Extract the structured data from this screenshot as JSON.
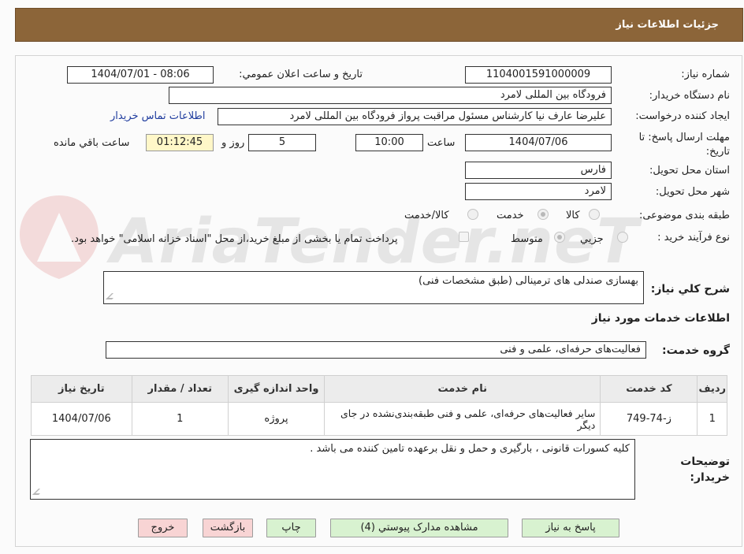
{
  "header": {
    "title": "جزئیات اطلاعات نیاز"
  },
  "form": {
    "need_number": {
      "label": "شماره نیاز:",
      "value": "1104001591000009"
    },
    "announce_date": {
      "label": "تاریخ و ساعت اعلان عمومي:",
      "value": "1404/07/01 - 08:06"
    },
    "buyer_org": {
      "label": "نام دستگاه خریدار:",
      "value": "فرودگاه بین المللی لامرد"
    },
    "requester": {
      "label": "ایجاد کننده درخواست:",
      "value": "علیرضا عارف نیا کارشناس مسئول مراقبت پرواز فرودگاه بین المللی لامرد"
    },
    "buyer_contact_link": "اطلاعات تماس خریدار",
    "deadline": {
      "label": "مهلت ارسال پاسخ: تا تاریخ:",
      "date": "1404/07/06",
      "time_label": "ساعت",
      "time": "10:00",
      "days": "5",
      "days_label": "روز و",
      "remaining": "01:12:45",
      "remaining_label": "ساعت باقي مانده"
    },
    "province": {
      "label": "استان محل تحویل:",
      "value": "فارس"
    },
    "city": {
      "label": "شهر محل تحویل:",
      "value": "لامرد"
    },
    "category": {
      "label": "طبقه بندی موضوعی:",
      "options": [
        "کالا",
        "خدمت",
        "کالا/خدمت"
      ],
      "selected": "خدمت"
    },
    "process": {
      "label": "نوع فرآیند خرید :",
      "options": [
        "جزيي",
        "متوسط"
      ],
      "selected": "متوسط",
      "payment_note": "پرداخت تمام یا بخشی از مبلغ خرید،از محل \"اسناد خزانه اسلامی\" خواهد بود."
    },
    "summary": {
      "label": "شرح کلي نیاز:",
      "value": "بهسازی صندلی های ترمینالی (طبق مشخصات فنی)"
    },
    "services_heading": "اطلاعات خدمات مورد نیاز",
    "service_group": {
      "label": "گروه خدمت:",
      "value": "فعالیت‌های حرفه‌ای، علمی و فنی"
    },
    "table": {
      "headers": [
        "ردیف",
        "کد خدمت",
        "نام خدمت",
        "واحد اندازه گیری",
        "تعداد / مقدار",
        "تاریخ نیاز"
      ],
      "rows": [
        [
          "1",
          "ز-74-749",
          "سایر فعالیت‌های حرفه‌ای، علمی و فنی طبقه‌بندی‌نشده در جای دیگر",
          "پروژه",
          "1",
          "1404/07/06"
        ]
      ]
    },
    "buyer_notes": {
      "label": "توضیحات خریدار:",
      "value": "کلیه کسورات قانونی ، بارگیری و حمل و نقل برعهده تامین کننده می باشد ."
    }
  },
  "buttons": {
    "reply": "پاسخ به نیاز",
    "attachments": "مشاهده مدارک پیوستي (4)",
    "print": "چاپ",
    "back": "بازگشت",
    "exit": "خروج"
  },
  "watermark": "AriaTender.neT",
  "colors": {
    "header_bg": "#8c6539",
    "link": "#1f3c9e",
    "time_bg": "#fff7c8",
    "btn_green": "#d8f2d0",
    "btn_pink": "#f8d4d4"
  }
}
